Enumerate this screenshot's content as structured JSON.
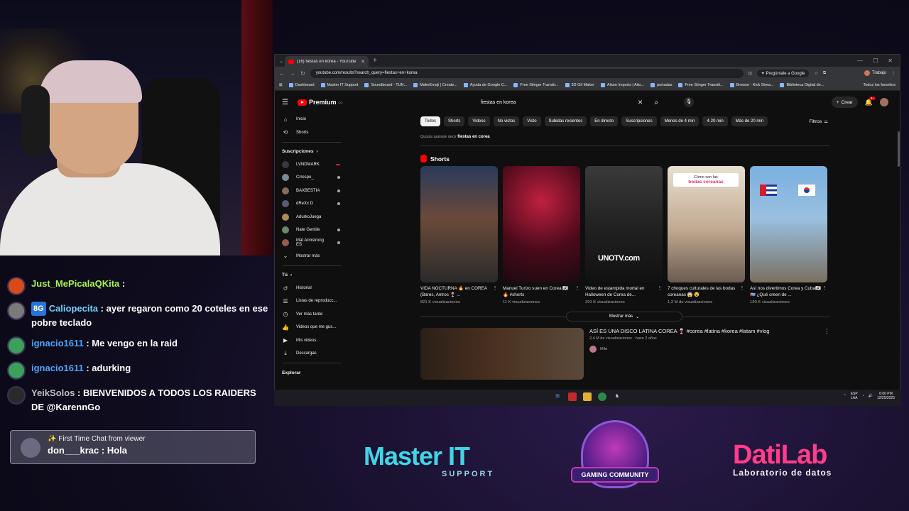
{
  "chat": {
    "messages": [
      {
        "user": "Just_MePicalaQKita",
        "text": "",
        "badge": "",
        "user_color": "#a8f050",
        "avatar_color": "#d94a1a"
      },
      {
        "user": "Caliopecita",
        "text": "ayer regaron como 20 coteles en ese pobre teclado",
        "badge": "8G",
        "user_color": "#6fd0ff",
        "avatar_color": "#7a7a7a"
      },
      {
        "user": "ignacio1611",
        "text": "Me vengo en la raid",
        "badge": "",
        "user_color": "#4aa4ff",
        "avatar_color": "#3aa05a"
      },
      {
        "user": "ignacio1611",
        "text": "adurking",
        "badge": "",
        "user_color": "#4aa4ff",
        "avatar_color": "#3aa05a"
      },
      {
        "user": "YeikSolos",
        "text": "BIENVENIDOS A TODOS LOS RAIDERS DE @KarennGo",
        "badge": "",
        "user_color": "#c0c0c0",
        "avatar_color": "#2a2a2a"
      }
    ],
    "first_time": {
      "title": "First Time Chat from viewer",
      "user": "don___krac",
      "text": "Hola"
    }
  },
  "logos": {
    "master_big": "Master IT",
    "master_small": "SUPPORT",
    "gaming_text": "GAMING COMMUNITY",
    "dati_big": "DatiLab",
    "dati_small": "Laboratorio de datos"
  },
  "browser": {
    "tab_title": "(16) fiestas en korea - YouTube",
    "url": "youtube.com/results?search_query=fiestas+en+korea",
    "ask_google": "Pregúntale a Google",
    "profile": "Trabajo",
    "bookmarks": [
      "Dashboard",
      "Master IT Support",
      "Soundboard - TUN...",
      "MakeEmoji | Create...",
      "Ayuda de Google C...",
      "Free Stinger Transiti...",
      "3D Gif Maker",
      "Aitum Imports | Aitu...",
      "portadas",
      "Free Stinger Transiti...",
      "Browse - Kick Strea...",
      "Biblioteca Digital de..."
    ],
    "all_bookmarks": "Todos los favoritos"
  },
  "youtube": {
    "logo": "Premium",
    "logo_sup": "CO",
    "search_query": "fiestas en korea",
    "create": "Crear",
    "notif_count": "9+",
    "sidebar": {
      "main": [
        {
          "label": "Inicio",
          "icon": "home-icon",
          "glyph": "⌂"
        },
        {
          "label": "Shorts",
          "icon": "shorts-icon",
          "glyph": "⟲"
        }
      ],
      "subs_header": "Suscripciones",
      "channels": [
        {
          "label": "LVNDMARK",
          "live": "red",
          "color": "#3a3a3a"
        },
        {
          "label": "Crrespo_",
          "live": "dot",
          "color": "#7a8a9a"
        },
        {
          "label": "BAXBESTIA",
          "live": "dot",
          "color": "#8a6a5a"
        },
        {
          "label": "dReXx D",
          "live": "dot",
          "color": "#5a5a7a"
        },
        {
          "label": "AdurkoJuega",
          "live": "",
          "color": "#b08a5a"
        },
        {
          "label": "Nate Gentile",
          "live": "dot",
          "color": "#6a8a6a"
        },
        {
          "label": "Mat Armstrong ES",
          "live": "dot",
          "color": "#9a5a4a"
        }
      ],
      "show_more": "Mostrar más",
      "you_header": "Tú",
      "you_items": [
        {
          "label": "Historial",
          "icon": "history-icon",
          "glyph": "↺"
        },
        {
          "label": "Listas de reproducc...",
          "icon": "playlist-icon",
          "glyph": "☰"
        },
        {
          "label": "Ver más tarde",
          "icon": "watch-later-icon",
          "glyph": "◷"
        },
        {
          "label": "Videos que me gus...",
          "icon": "like-icon",
          "glyph": "👍"
        },
        {
          "label": "Mis videos",
          "icon": "my-videos-icon",
          "glyph": "▶"
        },
        {
          "label": "Descargas",
          "icon": "download-icon",
          "glyph": "⤓"
        }
      ],
      "explore_header": "Explorar"
    },
    "chips": [
      "Todos",
      "Shorts",
      "Videos",
      "No vistos",
      "Visto",
      "Subidas recientes",
      "En directo",
      "Suscripciones",
      "Menos de 4 min",
      "4-20 min",
      "Más de 20 min"
    ],
    "filters": "Filtros",
    "did_you_mean_prefix": "Quizás quisiste decir",
    "did_you_mean_query": "fiestas en corea",
    "shorts_header": "Shorts",
    "shorts": [
      {
        "title": "VIDA NOCTURNA 🔥 en COREA (Bares, Antros 🍷 ...",
        "views": "821 K visualizaciones",
        "thumb": "t1",
        "overlay": "",
        "overlay_b": "",
        "watermark": ""
      },
      {
        "title": "Manuel Turizo suen en Corea 🇰🇷 🔥 #shorts",
        "views": "11 K visualizaciones",
        "thumb": "t2",
        "overlay": "",
        "overlay_b": "",
        "watermark": ""
      },
      {
        "title": "Video de estampida mortal en Halloween de Corea de...",
        "views": "291 K visualizaciones",
        "thumb": "t3",
        "overlay": "",
        "overlay_b": "",
        "watermark": "UNOTV.com"
      },
      {
        "title": "7 choques culturales de las bodas coreanas 😱 😮",
        "views": "1,2 M de visualizaciones",
        "thumb": "t4",
        "overlay": "Cómo son las",
        "overlay_b": "bodas coreanas",
        "watermark": ""
      },
      {
        "title": "Así nos divertimos Corea y Cuba🇰🇷🇨🇺 ¿Qué creen de ...",
        "views": "130 K visualizaciones",
        "thumb": "t5",
        "overlay": "",
        "overlay_b": "",
        "watermark": ""
      }
    ],
    "show_more": "Mostrar más",
    "video": {
      "title": "ASÍ ES UNA DISCO LATINA COREA 🍷 #corea #latina #korea #latam #vlog",
      "meta": "2,4 M de visualizaciones · hace 2 años",
      "channel": "Mila"
    }
  },
  "taskbar": {
    "lang": "ESP",
    "lang2": "LAA",
    "time": "6:00 PM",
    "date": "12/25/2025"
  }
}
